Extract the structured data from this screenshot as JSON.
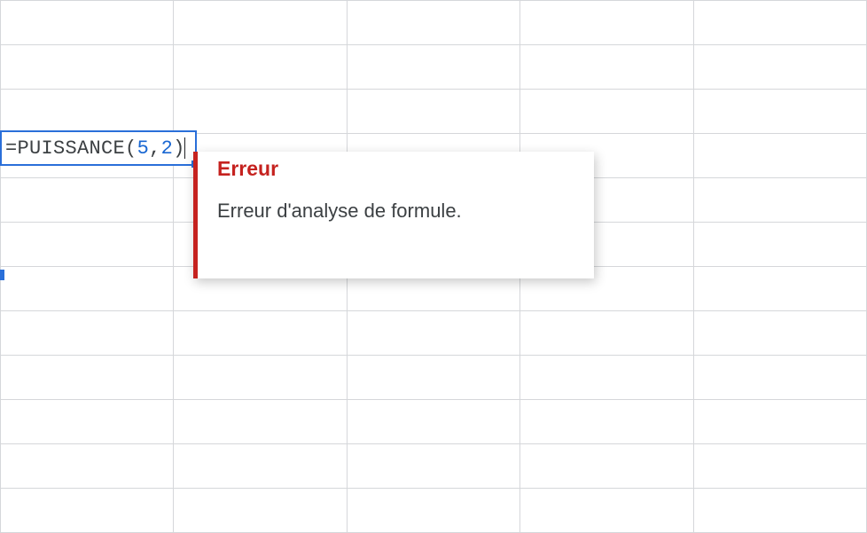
{
  "formula": {
    "eq": "=",
    "func": "PUISSANCE",
    "open": "(",
    "arg1": "5",
    "comma_sp": ", ",
    "arg2": "2",
    "close": ")"
  },
  "tooltip": {
    "title": "Erreur",
    "message": "Erreur d'analyse de formule."
  }
}
